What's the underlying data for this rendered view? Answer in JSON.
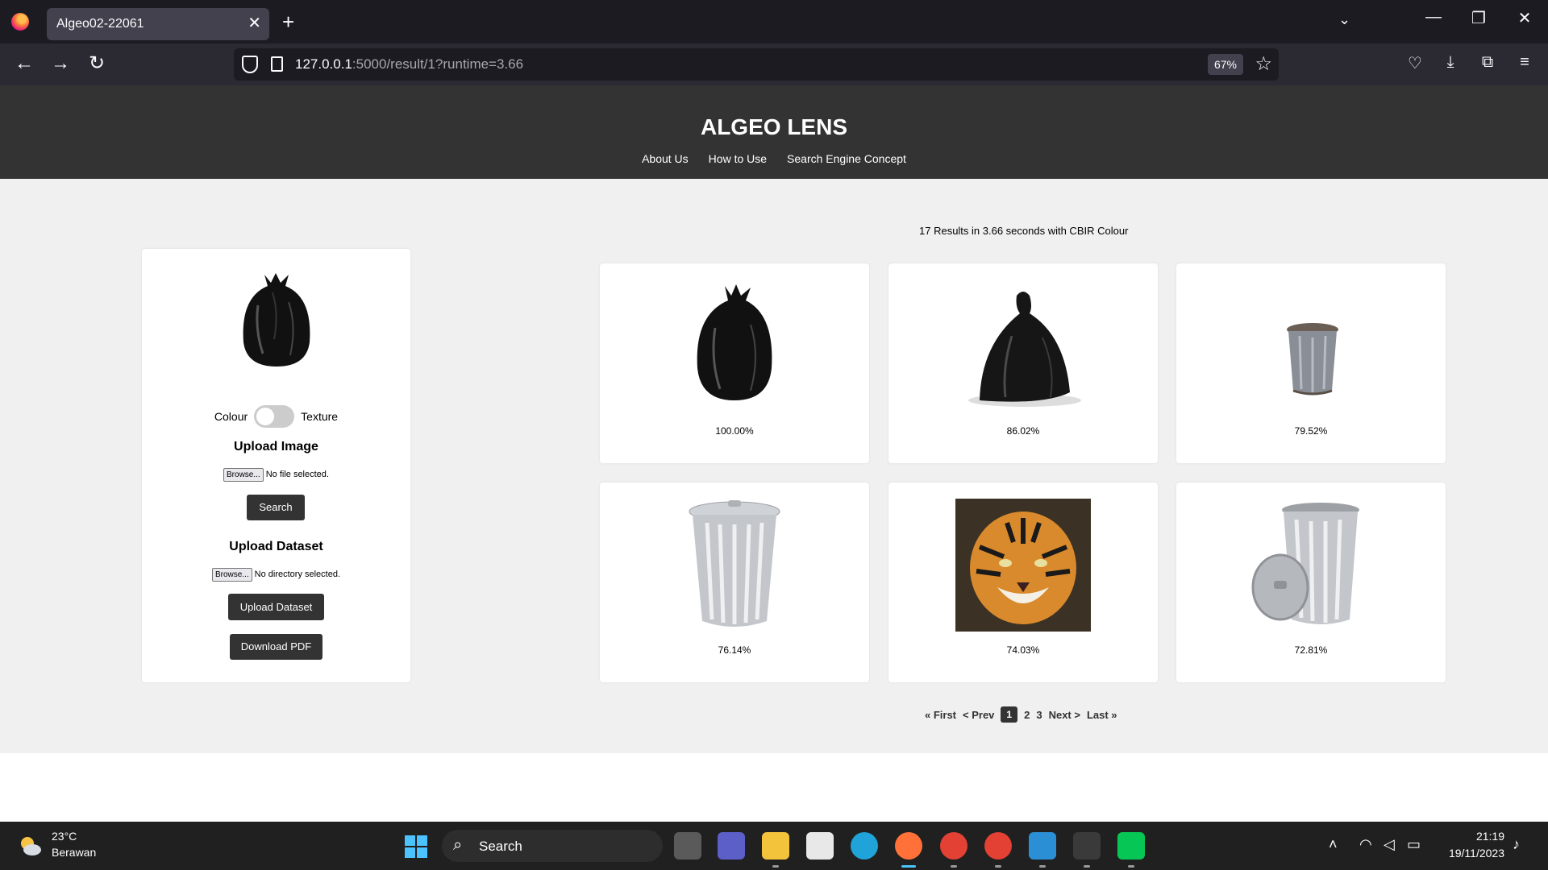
{
  "browser": {
    "tab_title": "Algeo02-22061",
    "tab_close": "✕",
    "new_tab": "+",
    "url_host": "127.0.0.1",
    "url_rest": ":5000/result/1?runtime=3.66",
    "zoom": "67%"
  },
  "site": {
    "title": "ALGEO LENS",
    "nav": [
      "About Us",
      "How to Use",
      "Search Engine Concept"
    ]
  },
  "panel": {
    "toggle_left": "Colour",
    "toggle_right": "Texture",
    "toggle_on": false,
    "upload_image_heading": "Upload Image",
    "browse_label": "Browse...",
    "image_file_status": "No file selected.",
    "search_button": "Search",
    "upload_dataset_heading": "Upload Dataset",
    "dataset_file_status": "No directory selected.",
    "upload_dataset_button": "Upload Dataset",
    "download_pdf_button": "Download PDF"
  },
  "results": {
    "summary": "17 Results in 3.66 seconds with CBIR Colour",
    "cards": [
      {
        "image": "black-garbage-bag",
        "score": "100.00%"
      },
      {
        "image": "black-garbage-bag-tied",
        "score": "86.02%"
      },
      {
        "image": "small-trash-can",
        "score": "79.52%"
      },
      {
        "image": "metal-trash-can",
        "score": "76.14%"
      },
      {
        "image": "tiger-face",
        "score": "74.03%"
      },
      {
        "image": "metal-trash-can-open",
        "score": "72.81%"
      }
    ]
  },
  "pagination": {
    "first": "« First",
    "prev": "< Prev",
    "current": "1",
    "pages": [
      "2",
      "3"
    ],
    "next": "Next >",
    "last": "Last »"
  },
  "taskbar": {
    "temperature": "23°C",
    "condition": "Berawan",
    "search_label": "Search",
    "time": "21:19",
    "date": "19/11/2023"
  }
}
